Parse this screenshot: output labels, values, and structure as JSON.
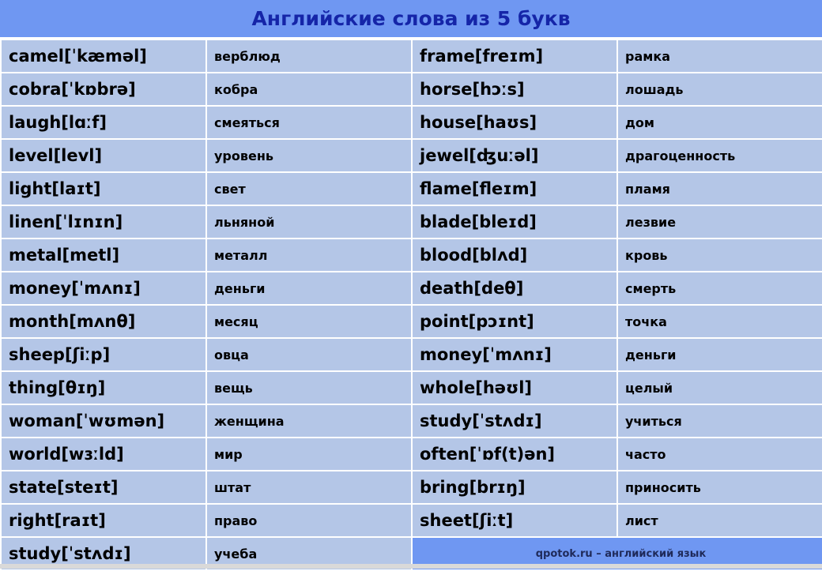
{
  "title": "Английские слова из 5 букв",
  "colors": {
    "header_bg": "#6f97f2",
    "title_text": "#1525a8",
    "cell_bg": "#b4c6e7",
    "grid": "#ffffff"
  },
  "left": [
    {
      "en": "camel[ˈkæməl]",
      "ru": "верблюд"
    },
    {
      "en": "cobra[ˈkɒbrə]",
      "ru": "кобра"
    },
    {
      "en": "laugh[lɑːf]",
      "ru": "смеяться"
    },
    {
      "en": "level[levl]",
      "ru": "уровень"
    },
    {
      "en": "light[laɪt]",
      "ru": "свет"
    },
    {
      "en": "linen[ˈlɪnɪn]",
      "ru": "льняной"
    },
    {
      "en": "metal[metl]",
      "ru": "металл"
    },
    {
      "en": "money[ˈmʌnɪ]",
      "ru": "деньги"
    },
    {
      "en": "month[mʌnθ]",
      "ru": "месяц"
    },
    {
      "en": "sheep[ʃiːp]",
      "ru": "овца"
    },
    {
      "en": "thing[θɪŋ]",
      "ru": "вещь"
    },
    {
      "en": "woman[ˈwʊmən]",
      "ru": "женщина"
    },
    {
      "en": "world[wɜːld]",
      "ru": "мир"
    },
    {
      "en": "state[steɪt]",
      "ru": "штат"
    },
    {
      "en": "right[raɪt]",
      "ru": "право"
    },
    {
      "en": "study[ˈstʌdɪ]",
      "ru": "учеба"
    }
  ],
  "right": [
    {
      "en": "frame[freɪm]",
      "ru": "рамка"
    },
    {
      "en": "horse[hɔːs]",
      "ru": "лошадь"
    },
    {
      "en": "house[haʊs]",
      "ru": "дом"
    },
    {
      "en": "jewel[ʤuːəl]",
      "ru": "драгоценность"
    },
    {
      "en": "flame[fleɪm]",
      "ru": "пламя"
    },
    {
      "en": "blade[bleɪd]",
      "ru": "лезвие"
    },
    {
      "en": "blood[blʌd]",
      "ru": "кровь"
    },
    {
      "en": "death[deθ]",
      "ru": "смерть"
    },
    {
      "en": "point[pɔɪnt]",
      "ru": "точка"
    },
    {
      "en": "money[ˈmʌnɪ]",
      "ru": "деньги"
    },
    {
      "en": "whole[həʊl]",
      "ru": "целый"
    },
    {
      "en": "study[ˈstʌdɪ]",
      "ru": "учиться"
    },
    {
      "en": "often[ˈɒf(t)ən]",
      "ru": "часто"
    },
    {
      "en": "bring[brɪŋ]",
      "ru": "приносить"
    },
    {
      "en": "sheet[ʃiːt]",
      "ru": "лист"
    }
  ],
  "credit": "qpotok.ru – английский язык"
}
